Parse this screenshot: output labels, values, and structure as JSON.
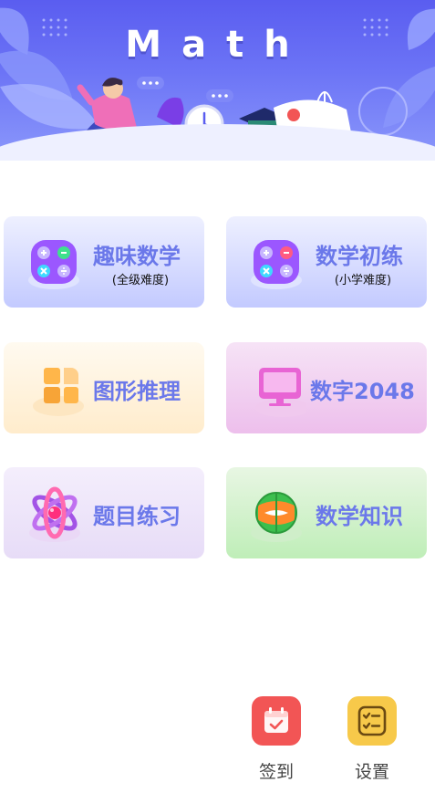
{
  "banner": {
    "title": "Math"
  },
  "tiles": [
    {
      "title": "趣味数学",
      "subtitle": "(全级难度)",
      "icon": "calculator-icon"
    },
    {
      "title": "数学初练",
      "subtitle": "(小学难度)",
      "icon": "calculator-icon"
    },
    {
      "title": "图形推理",
      "icon": "shapes-icon"
    },
    {
      "title": "数字2048",
      "icon": "monitor-icon"
    },
    {
      "title": "题目练习",
      "icon": "atom-icon"
    },
    {
      "title": "数学知识",
      "icon": "globe-icon"
    }
  ],
  "bottom_actions": [
    {
      "label": "签到",
      "icon": "calendar-check-icon",
      "color": "#f25555"
    },
    {
      "label": "设置",
      "icon": "checklist-icon",
      "color": "#f7c94a"
    }
  ],
  "colors": {
    "banner": "#5a5df0",
    "tile_title": "#6b78ea"
  }
}
